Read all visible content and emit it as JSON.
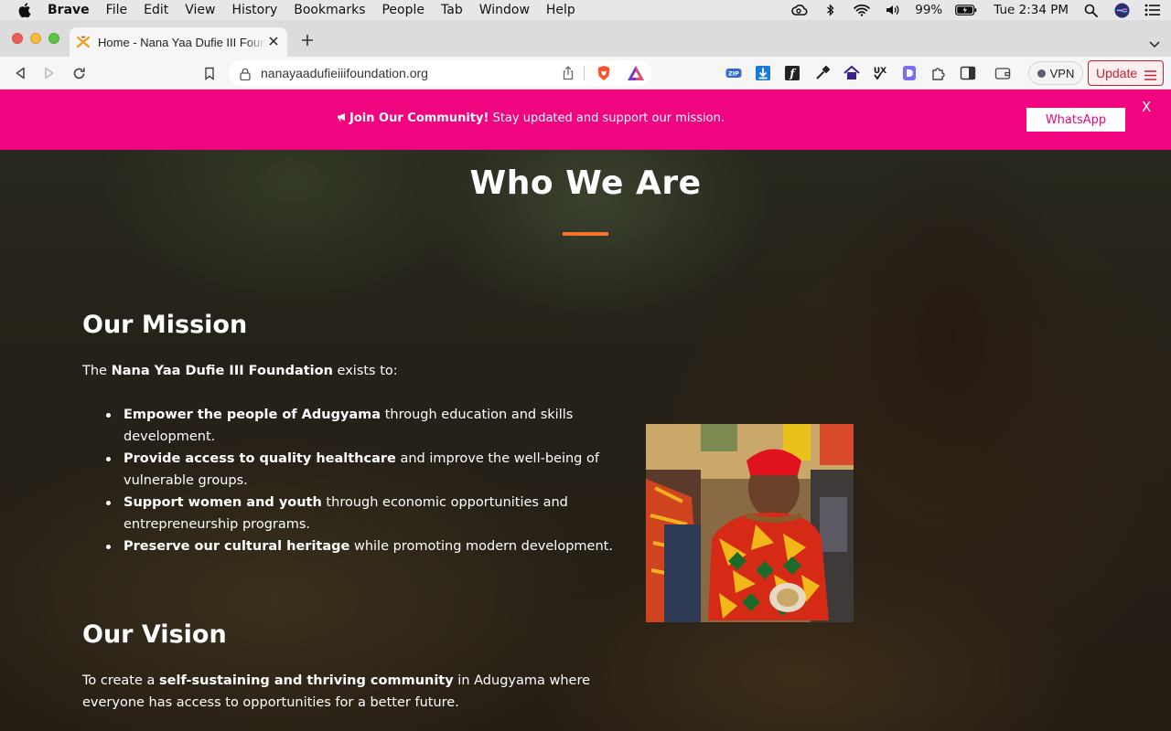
{
  "menubar": {
    "app": "Brave",
    "items": [
      "File",
      "Edit",
      "View",
      "History",
      "Bookmarks",
      "People",
      "Tab",
      "Window",
      "Help"
    ],
    "battery": "99%",
    "clock": "Tue 2:34 PM"
  },
  "tabs": [
    {
      "title": "Home - Nana Yaa Dufie III Foundation",
      "favicon": "foundation-favicon"
    }
  ],
  "toolbar": {
    "url": "nanayaadufieiiifoundation.org",
    "extension_badge": "18",
    "vpn_label": "VPN",
    "update_label": "Update"
  },
  "promo": {
    "icon": "megaphone-icon",
    "headline": "Join Our Community!",
    "text": " Stay updated and support our mission.",
    "button_label": "WhatsApp",
    "close_label": "X"
  },
  "main": {
    "section_title": "Who We Are",
    "mission": {
      "heading": "Our Mission",
      "intro_prefix": "The ",
      "intro_bold": "Nana Yaa Dufie III Foundation",
      "intro_suffix": " exists to:",
      "goals": [
        {
          "bold": "Empower the people of Adugyama",
          "text": " through education and skills development."
        },
        {
          "bold": "Provide access to quality healthcare",
          "text": " and improve the well-being of vulnerable groups."
        },
        {
          "bold": "Support women and youth",
          "text": " through economic opportunities and entrepreneurship programs."
        },
        {
          "bold": "Preserve our cultural heritage",
          "text": " while promoting modern development."
        }
      ]
    },
    "vision": {
      "heading": "Our Vision",
      "prefix": "To create a ",
      "bold": "self-sustaining and thriving community",
      "suffix": " in Adugyama where everyone has access to opportunities for a better future."
    }
  },
  "colors": {
    "promo_bg": "#f0047f",
    "accent_underline": "#f5732a",
    "update_red": "#c8202f"
  }
}
